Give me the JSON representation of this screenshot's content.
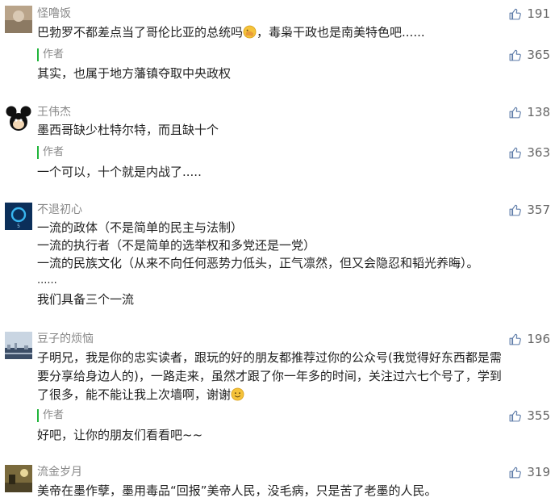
{
  "comments": [
    {
      "nickname": "怪噜饭",
      "likes": "191",
      "text_a": "巴勃罗不都差点当了哥伦比亚的总统吗",
      "text_b": "，毒枭干政也是南美特色吧......",
      "reply_label": "作者",
      "reply_likes": "365",
      "reply_text": "其实，也属于地方藩镇夺取中央政权"
    },
    {
      "nickname": "王伟杰",
      "likes": "138",
      "text": "墨西哥缺少杜特尔特，而且缺十个",
      "reply_label": "作者",
      "reply_likes": "363",
      "reply_text": "一个可以，十个就是内战了....."
    },
    {
      "nickname": "不退初心",
      "likes": "357",
      "lines": [
        "一流的政体（不是简单的民主与法制）",
        "一流的执行者（不是简单的选举权和多党还是一党）",
        "一流的民族文化（从来不向任何恶势力低头，正气凛然，但又会隐忍和韬光养晦）。",
        "......",
        "我们具备三个一流"
      ]
    },
    {
      "nickname": "豆子的烦恼",
      "likes": "196",
      "lines": [
        "子明兄，我是你的忠实读者，跟玩的好的朋友都推荐过你的公众号(我觉得好东西都是需",
        "要分享给身边人的)，一路走来，虽然才跟了你一年多的时间，关注过六七个号了，学到"
      ],
      "line3": "了很多，能不能让我上次墙啊，谢谢",
      "reply_label": "作者",
      "reply_likes": "355",
      "reply_text": "好吧，让你的朋友们看看吧~~"
    },
    {
      "nickname": "流金岁月",
      "likes": "319",
      "text": "美帝在墨作孽，墨用毒品“回报”美帝人民，没毛病，只是苦了老墨的人民。"
    }
  ],
  "colors": {
    "accent": "#21b53b",
    "like_icon": "#5d7ba8",
    "muted": "#888888"
  }
}
